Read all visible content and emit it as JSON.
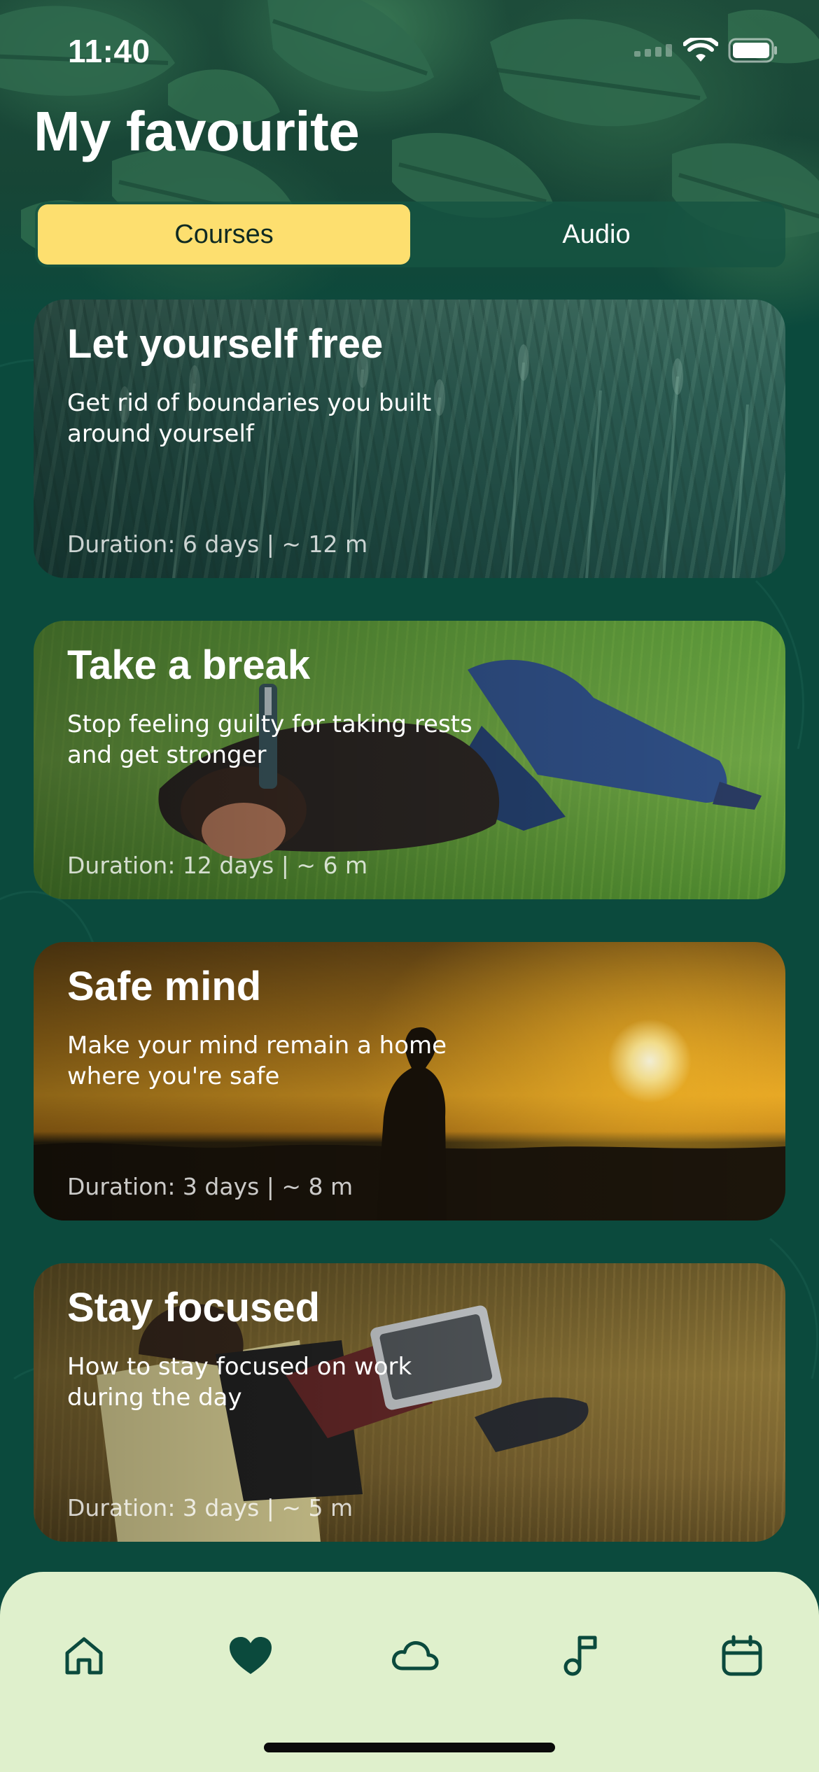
{
  "status_bar": {
    "time": "11:40"
  },
  "header": {
    "title": "My favourite"
  },
  "segmented": {
    "tabs": [
      {
        "label": "Courses",
        "active": true
      },
      {
        "label": "Audio",
        "active": false
      }
    ]
  },
  "courses": [
    {
      "title": "Let yourself free",
      "description": "Get rid of boundaries you built around yourself",
      "duration": "Duration: 6 days | ~ 12 m"
    },
    {
      "title": "Take a break",
      "description": "Stop feeling guilty for taking rests and get stronger",
      "duration": "Duration: 12 days | ~ 6 m"
    },
    {
      "title": "Safe mind",
      "description": "Make your mind remain a home where you're safe",
      "duration": "Duration: 3 days | ~ 8 m"
    },
    {
      "title": "Stay focused",
      "description": "How to stay focused on work during the day",
      "duration": "Duration: 3 days | ~ 5 m"
    }
  ],
  "tab_bar": {
    "items": [
      {
        "icon": "home-icon",
        "active": false
      },
      {
        "icon": "heart-icon",
        "active": true
      },
      {
        "icon": "cloud-icon",
        "active": false
      },
      {
        "icon": "music-note-icon",
        "active": false
      },
      {
        "icon": "calendar-icon",
        "active": false
      }
    ]
  },
  "colors": {
    "background": "#0b4a3d",
    "accent": "#fddf6f",
    "tab_bar": "#dff0cc",
    "icon": "#0b4a3d"
  }
}
